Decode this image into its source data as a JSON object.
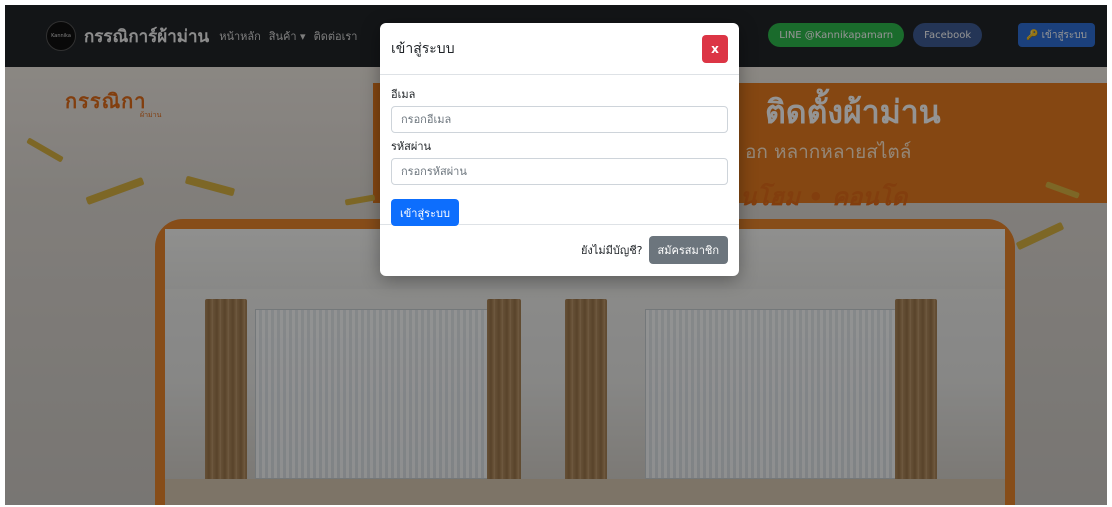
{
  "navbar": {
    "logo_text": "Kannika",
    "brand": "กรรณิการ์ผ้าม่าน",
    "links": [
      "หน้าหลัก",
      "สินค้า ▾",
      "ติดต่อเรา"
    ],
    "line_label": "LINE @Kannikapamarn",
    "facebook_label": "Facebook",
    "login_label": "เข้าสู่ระบบ",
    "login_icon": "key-icon"
  },
  "hero": {
    "logo": "กรรณิกา",
    "logo_sub": "ผ้าม่าน",
    "title": "ติดตั้งผ้าม่าน",
    "subtitle": "อก หลากหลายสไตล์",
    "tags": "นโฮม • คอนโด"
  },
  "modal": {
    "title": "เข้าสู่ระบบ",
    "close_label": "x",
    "email_label": "อีเมล",
    "email_placeholder": "กรอกอีเมล",
    "password_label": "รหัสผ่าน",
    "password_placeholder": "กรอกรหัสผ่าน",
    "submit_label": "เข้าสู่ระบบ",
    "no_account_text": "ยังไม่มีบัญชี?",
    "register_label": "สมัครสมาชิก"
  },
  "colors": {
    "navbar_bg": "#222529",
    "line_green": "#2db84c",
    "facebook_blue": "#3e5c94",
    "primary": "#0d6efd",
    "danger": "#dc3545",
    "secondary": "#6c757d",
    "brand_orange": "#e57a1f"
  }
}
